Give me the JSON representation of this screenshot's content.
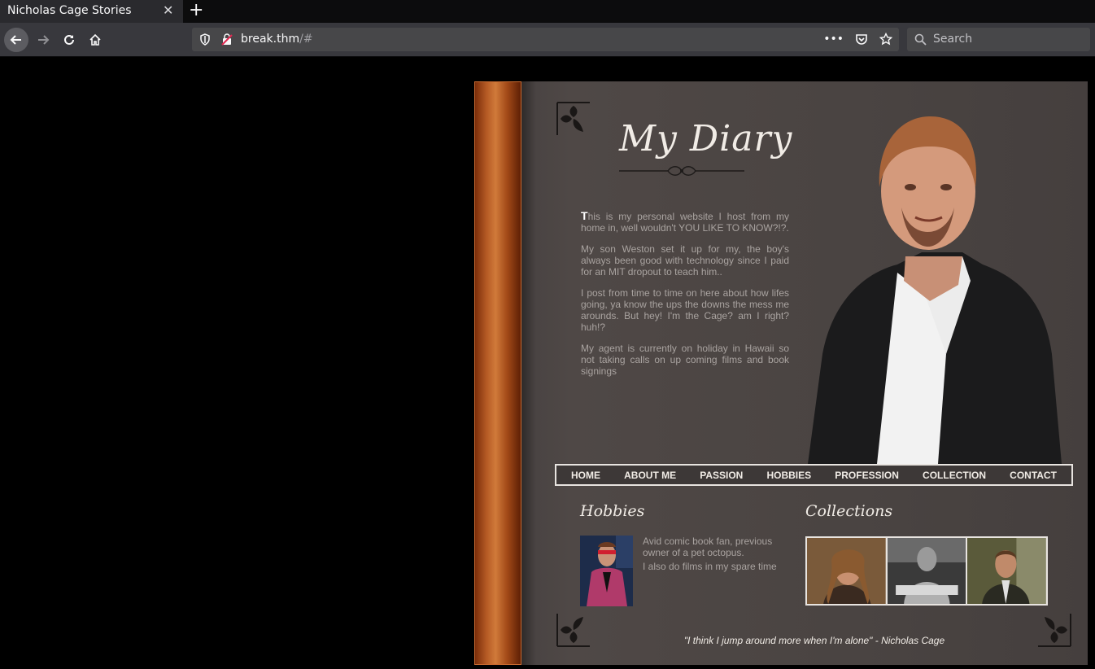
{
  "browser": {
    "tab_title": "Nicholas Cage Stories",
    "url_host": "break.thm",
    "url_rest": "/#",
    "search_placeholder": "Search",
    "url_menu": "•••"
  },
  "page": {
    "title": "My Diary",
    "intro": {
      "dropcap": "T",
      "p1_rest": "his is my personal website I host from my home in, well wouldn't YOU LIKE TO KNOW?!?.",
      "p2": "My son Weston set it up for my, the boy's always been good with technology since I paid for an MIT dropout to teach him..",
      "p3": "I post from time to time on here about how lifes going, ya know the ups the downs the mess me arounds. But hey! I'm the Cage? am I right? huh!?",
      "p4": "My agent is currently on holiday in Hawaii so not taking calls on up coming films and book signings"
    },
    "menu": [
      "HOME",
      "ABOUT ME",
      "PASSION",
      "HOBBIES",
      "PROFESSION",
      "COLLECTION",
      "CONTACT"
    ],
    "hobbies": {
      "title": "Hobbies",
      "line1": "Avid comic book fan, previous owner of a pet octopus.",
      "line2": "I also do films in my spare time"
    },
    "collections": {
      "title": "Collections"
    },
    "quote": "\"I think I jump around more when I'm alone\" - Nicholas Cage"
  },
  "colors": {
    "spine": "#b55a24",
    "page_bg": "#4a4442",
    "text": "#a9a3a0",
    "heading": "#f1ece6"
  }
}
